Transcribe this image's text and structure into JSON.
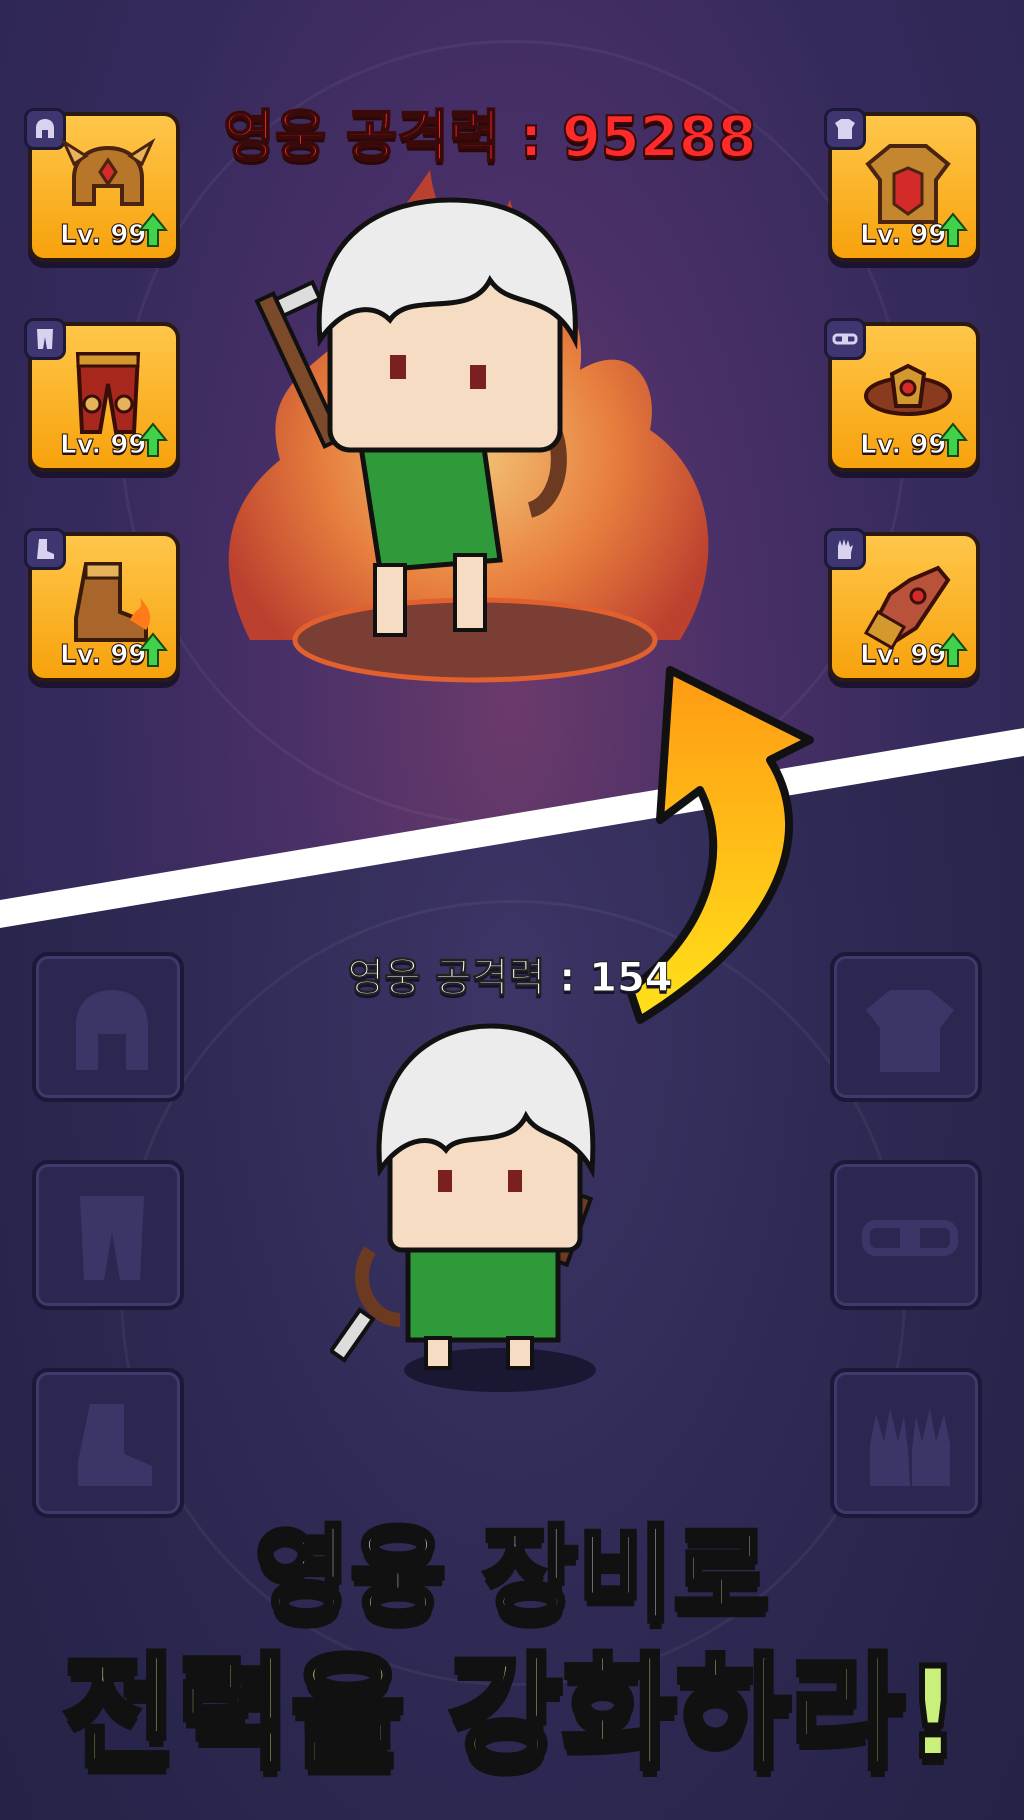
{
  "stat_top": {
    "text": "영웅 공격력 : 95288"
  },
  "stat_bottom": {
    "text": "영웅 공격력 : 154"
  },
  "equipment_upgraded": {
    "left": [
      {
        "slot": "helmet",
        "icon": "helmet-icon",
        "level": "Lv. 99"
      },
      {
        "slot": "pants",
        "icon": "pants-icon",
        "level": "Lv. 99"
      },
      {
        "slot": "boots",
        "icon": "boots-icon",
        "level": "Lv. 99"
      }
    ],
    "right": [
      {
        "slot": "armor",
        "icon": "armor-icon",
        "level": "Lv. 99"
      },
      {
        "slot": "belt",
        "icon": "belt-icon",
        "level": "Lv. 99"
      },
      {
        "slot": "gloves",
        "icon": "gloves-icon",
        "level": "Lv. 99"
      }
    ]
  },
  "slogan": {
    "line1": "영웅 장비로",
    "line2": "전력을 강화하라!"
  },
  "colors": {
    "slot_active": "#f7a20c",
    "stat_top": "#ff2a2a",
    "slogan_line2": "#c8f07a",
    "arrow": "#ffd21a"
  }
}
